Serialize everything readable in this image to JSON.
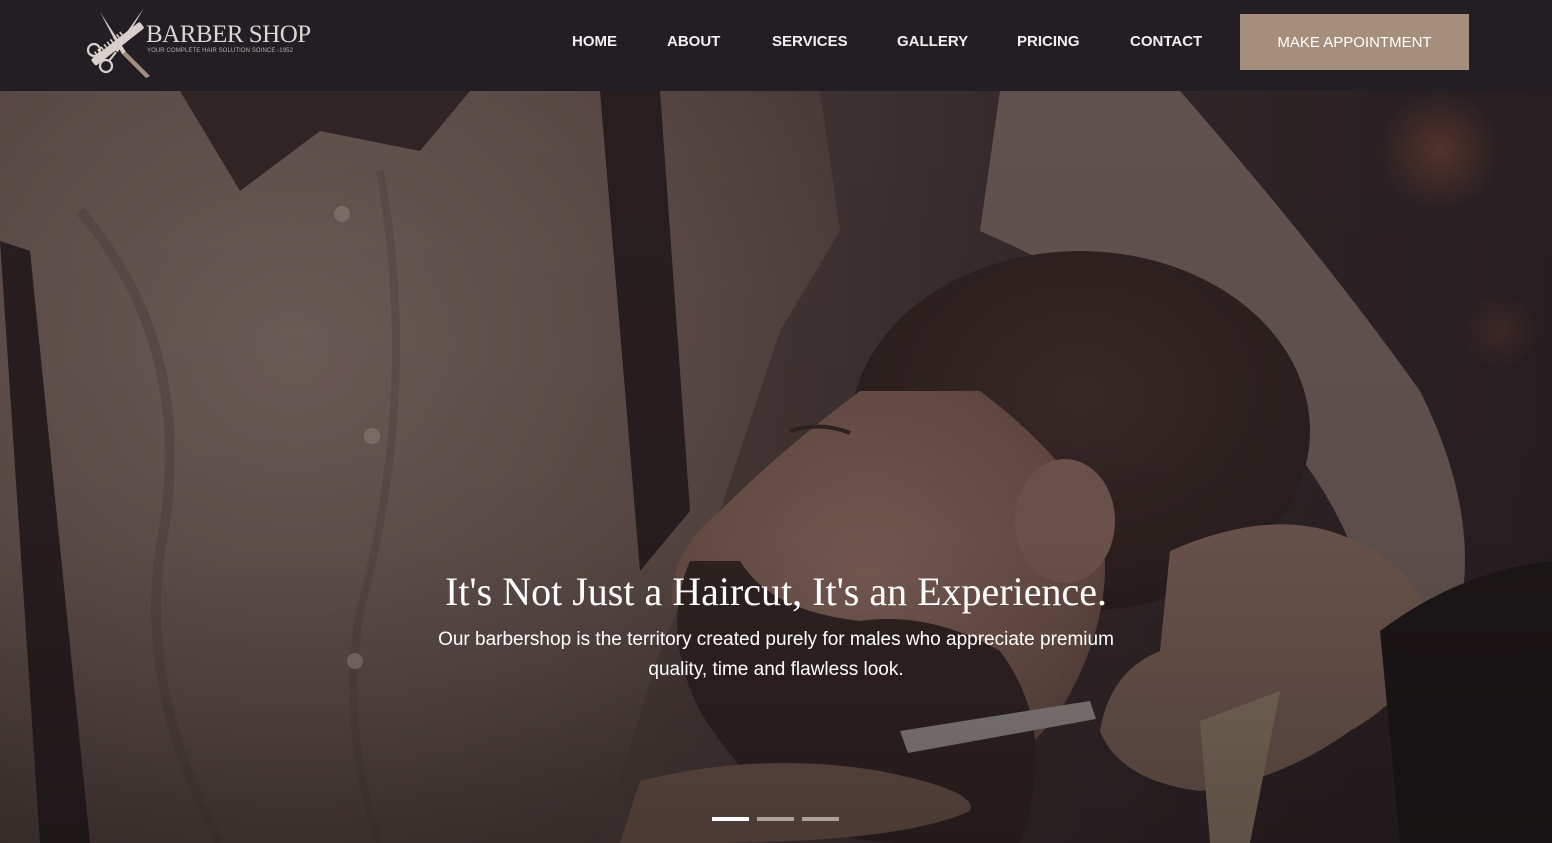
{
  "brand": {
    "name": "BARBER SHOP",
    "tagline": "YOUR COMPLETE HAIR SOLUTION SOINCE -1952"
  },
  "nav": {
    "items": [
      "HOME",
      "ABOUT",
      "SERVICES",
      "GALLERY",
      "PRICING",
      "CONTACT"
    ],
    "cta_label": "MAKE APPOINTMENT"
  },
  "hero": {
    "headline": "It's Not Just a Haircut, It's an Experience.",
    "subtext": "Our barbershop is the territory created purely for males who appreciate premium quality, time and flawless look.",
    "slides": {
      "count": 3,
      "active_index": 0
    }
  },
  "colors": {
    "header_bg": "#231e23",
    "cta_bg": "#a58f7c",
    "text_light": "#f2f0ee"
  },
  "icons": {
    "logo": "comb-and-scissors-icon"
  }
}
